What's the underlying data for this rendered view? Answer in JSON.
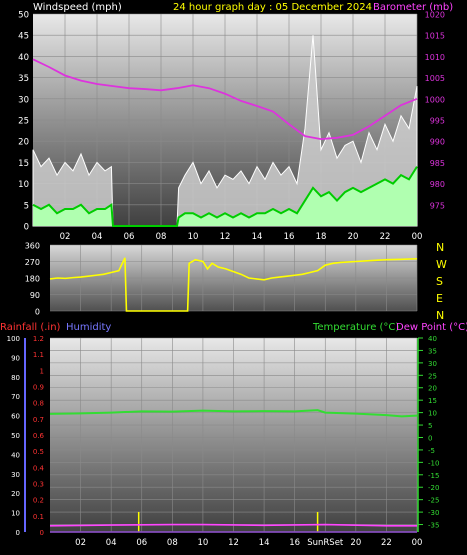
{
  "header": {
    "left_title": "Windspeed (mph)",
    "center_title": "24 hour graph day : 05 December 2024",
    "right_title": "Barometer (mb)"
  },
  "direction_labels": [
    "N",
    "W",
    "S",
    "E",
    "N"
  ],
  "lower_header": {
    "rain": "Rainfall (.in)",
    "humidity": "Humidity",
    "temperature": "Temperature (°C)",
    "dewpoint": "Dew Point (°C)"
  },
  "sun_label": "SunRSet",
  "colors": {
    "windspeed": "#ffffff",
    "gust_fill": "#cccccc",
    "wind_avg_fill": "#b0ffb0",
    "wind_avg_line": "#00cc00",
    "barometer": "#dd33dd",
    "direction": "#ffff00",
    "temperature": "#33dd33",
    "dewpoint": "#ff44ff",
    "rain": "#ff0000",
    "humidity": "#6666ff",
    "sun_marker": "#ffff00"
  },
  "chart_data": [
    {
      "type": "area",
      "title": "Windspeed (mph)",
      "x_ticks": [
        "02",
        "04",
        "06",
        "08",
        "10",
        "12",
        "14",
        "16",
        "18",
        "20",
        "22",
        "00"
      ],
      "x_unit": "hour",
      "left_axis": {
        "label": "Windspeed (mph)",
        "ticks": [
          0,
          5,
          10,
          15,
          20,
          25,
          30,
          35,
          40,
          45,
          50
        ],
        "ylim": [
          0,
          50
        ]
      },
      "right_axis": {
        "label": "Barometer (mb)",
        "ticks": [
          975,
          980,
          985,
          990,
          995,
          1000,
          1005,
          1010,
          1015,
          1020
        ],
        "ylim": [
          970,
          1020
        ]
      },
      "series": [
        {
          "name": "Barometer (mb)",
          "axis": "right",
          "x": [
            0,
            1,
            2,
            3,
            4,
            5,
            6,
            7,
            8,
            9,
            10,
            11,
            12,
            13,
            14,
            15,
            16,
            17,
            18,
            19,
            20,
            21,
            22,
            23,
            24
          ],
          "values": [
            1009.3,
            1007.5,
            1005.5,
            1004.3,
            1003.5,
            1003.0,
            1002.5,
            1002.3,
            1002.0,
            1002.5,
            1003.2,
            1002.5,
            1001.2,
            999.5,
            998.3,
            997.0,
            994.0,
            991.2,
            990.5,
            990.8,
            991.5,
            993.5,
            996.0,
            998.5,
            1000.0
          ]
        },
        {
          "name": "Gust (mph)",
          "axis": "left",
          "x": [
            0,
            0.5,
            1,
            1.5,
            2,
            2.5,
            3,
            3.5,
            4,
            4.5,
            4.9,
            5.0,
            9.0,
            9.1,
            9.5,
            10,
            10.5,
            11,
            11.5,
            12,
            12.5,
            13,
            13.5,
            14,
            14.5,
            15,
            15.5,
            16,
            16.5,
            17,
            17.5,
            18,
            18.5,
            19,
            19.5,
            20,
            20.5,
            21,
            21.5,
            22,
            22.5,
            23,
            23.5,
            24
          ],
          "values": [
            18,
            14,
            16,
            12,
            15,
            13,
            17,
            12,
            15,
            13,
            14,
            0,
            0,
            9,
            12,
            15,
            10,
            13,
            9,
            12,
            11,
            13,
            10,
            14,
            11,
            15,
            12,
            14,
            10,
            23,
            45,
            18,
            22,
            16,
            19,
            20,
            15,
            22,
            18,
            24,
            20,
            26,
            23,
            33
          ]
        },
        {
          "name": "Average (mph)",
          "axis": "left",
          "x": [
            0,
            0.5,
            1,
            1.5,
            2,
            2.5,
            3,
            3.5,
            4,
            4.5,
            4.9,
            5.0,
            9.0,
            9.1,
            9.5,
            10,
            10.5,
            11,
            11.5,
            12,
            12.5,
            13,
            13.5,
            14,
            14.5,
            15,
            15.5,
            16,
            16.5,
            17,
            17.5,
            18,
            18.5,
            19,
            19.5,
            20,
            20.5,
            21,
            21.5,
            22,
            22.5,
            23,
            23.5,
            24
          ],
          "values": [
            5,
            4,
            5,
            3,
            4,
            4,
            5,
            3,
            4,
            4,
            5,
            0,
            0,
            2,
            3,
            3,
            2,
            3,
            2,
            3,
            2,
            3,
            2,
            3,
            3,
            4,
            3,
            4,
            3,
            6,
            9,
            7,
            8,
            6,
            8,
            9,
            8,
            9,
            10,
            11,
            10,
            12,
            11,
            14
          ]
        }
      ]
    },
    {
      "type": "line",
      "title": "Wind direction",
      "x_ticks": [
        "02",
        "04",
        "06",
        "08",
        "10",
        "12",
        "14",
        "16",
        "18",
        "20",
        "22",
        "00"
      ],
      "left_axis": {
        "ticks": [
          0,
          90,
          180,
          270,
          360
        ],
        "ylim": [
          0,
          360
        ]
      },
      "series": [
        {
          "name": "Direction (deg)",
          "x": [
            0,
            0.5,
            1,
            1.5,
            2,
            2.5,
            3,
            3.5,
            4,
            4.5,
            4.9,
            5.0,
            9.0,
            9.1,
            9.5,
            10,
            10.3,
            10.6,
            11,
            11.5,
            12,
            12.5,
            13,
            13.5,
            14,
            14.5,
            15,
            15.5,
            16,
            16.5,
            17,
            17.5,
            18,
            18.5,
            19,
            20,
            21,
            22,
            23,
            24
          ],
          "values": [
            175,
            180,
            178,
            182,
            185,
            190,
            195,
            200,
            210,
            220,
            290,
            0,
            0,
            260,
            280,
            270,
            230,
            260,
            240,
            230,
            215,
            200,
            180,
            175,
            170,
            180,
            185,
            190,
            195,
            200,
            210,
            220,
            250,
            260,
            265,
            270,
            275,
            280,
            282,
            285
          ]
        }
      ]
    },
    {
      "type": "line",
      "title": "Temperature / Dew Point / Rainfall / Humidity",
      "x_ticks": [
        "02",
        "04",
        "06",
        "08",
        "10",
        "12",
        "14",
        "16",
        "SunRSet",
        "20",
        "22",
        "00"
      ],
      "humidity_axis": {
        "label": "Humidity",
        "ticks": [
          0,
          10,
          20,
          30,
          40,
          50,
          60,
          70,
          80,
          90,
          100
        ],
        "ylim": [
          0,
          100
        ]
      },
      "rain_axis": {
        "label": "Rainfall (.in)",
        "ticks": [
          0,
          0.1,
          0.2,
          0.3,
          0.4,
          0.5,
          0.6,
          0.7,
          0.8,
          0.9,
          1,
          1.1,
          1.2
        ],
        "ylim": [
          0,
          1.2
        ]
      },
      "temp_axis": {
        "label": "Temperature (°C)",
        "ticks": [
          -35,
          -30,
          -25,
          -20,
          -15,
          -10,
          -5,
          0,
          5,
          10,
          15,
          20,
          25,
          30,
          35,
          40
        ],
        "ylim": [
          -38,
          40
        ]
      },
      "series": [
        {
          "name": "Temperature (°C)",
          "axis": "temp",
          "x": [
            0,
            2,
            4,
            6,
            8,
            10,
            12,
            14,
            16,
            17.5,
            18,
            20,
            22,
            23,
            24
          ],
          "values": [
            9.5,
            9.7,
            10.0,
            10.5,
            10.4,
            10.8,
            10.5,
            10.6,
            10.5,
            11.0,
            10.0,
            9.6,
            9.0,
            8.5,
            8.8
          ]
        },
        {
          "name": "Dew Point (°C)",
          "axis": "temp",
          "x": [
            0,
            4,
            8,
            10,
            14,
            18,
            22,
            24
          ],
          "values": [
            -35.5,
            -35.2,
            -35,
            -35,
            -35.3,
            -35,
            -35.5,
            -35.5
          ]
        },
        {
          "name": "Rainfall (.in)",
          "axis": "rain",
          "x": [
            0,
            24
          ],
          "values": [
            0,
            0
          ]
        },
        {
          "name": "Humidity",
          "axis": "humidity",
          "x": [
            0,
            24
          ],
          "values": [
            0,
            0
          ]
        }
      ],
      "sun_events": [
        5.8,
        17.5
      ]
    }
  ]
}
